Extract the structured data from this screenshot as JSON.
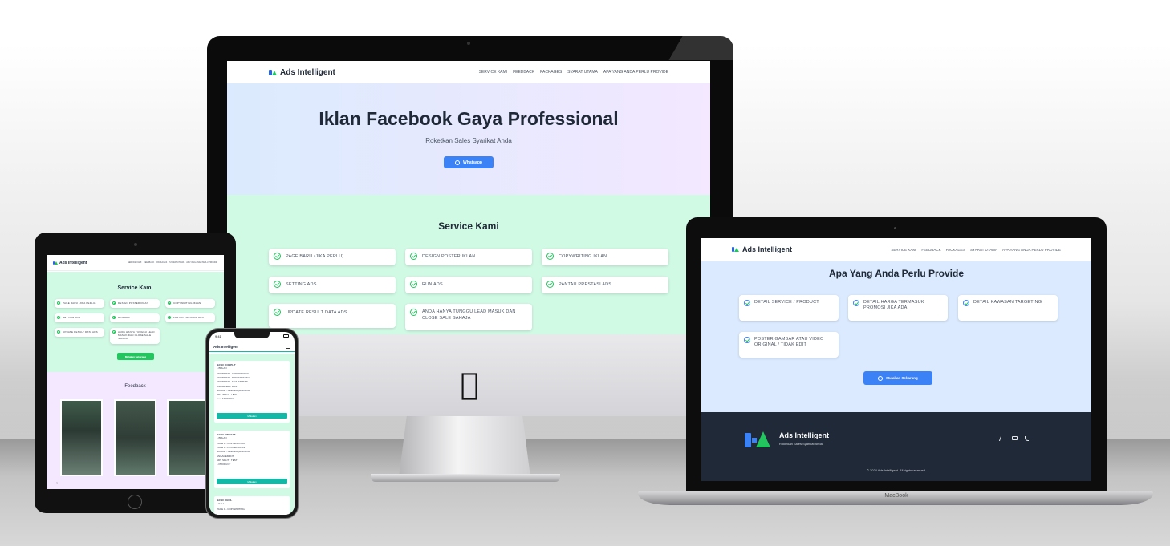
{
  "brand": "Ads Intelligent",
  "brand_icon_text": "FA",
  "nav_links": [
    "SERVICE KAMI",
    "FEEDBACK",
    "PACKAGES",
    "SYARAT UTAMA",
    "APA YANG ANDA PERLU PROVIDE"
  ],
  "imac": {
    "hero_title": "Iklan Facebook Gaya Professional",
    "hero_subtitle": "Roketkan Sales Syarikat Anda",
    "hero_button": "Whatsapp",
    "section_title": "Service Kami",
    "services": [
      "PAGE BARU (JIKA PERLU)",
      "DESIGN POSTER IKLAN",
      "COPYWRITING IKLAN",
      "SETTING ADS",
      "RUN ADS",
      "PANTAU PRESTASI ADS",
      "UPDATE RESULT DATA ADS",
      "ANDA HANYA TUNGGU LEAD MASUK DAN CLOSE SALE SAHAJA"
    ],
    "device_label": ""
  },
  "laptop": {
    "section_title": "Apa Yang Anda Perlu Provide",
    "items": [
      "DETAIL SERVICE / PRODUCT",
      "DETAIL HARGA TERMASUK PROMOSI JIKA ADA",
      "DETAIL KAWASAN TARGETING",
      "POSTER GAMBAR ATAU VIDEO ORIGINAL / TIDAK EDIT"
    ],
    "cta_button": "Mulakan Sekarang",
    "footer_brand": "Ads Intelligent",
    "footer_tagline": "Roketkan Sales Syarikat Anda",
    "footer_copyright": "© 2024 Ads Intelligent. All rights reserved.",
    "device_label": "MacBook"
  },
  "tablet": {
    "section_title": "Service Kami",
    "services": [
      "PAGE BARU (JIKA PERLU)",
      "DESIGN POSTER IKLAN",
      "COPYWRITING IKLAN",
      "SETTING ADS",
      "RUN ADS",
      "PANTAU PRESTASI ADS",
      "UPDATE RESULT DATA ADS",
      "ANDA HANYA TUNGGU LEAD MASUK DAN CLOSE SALE SAHAJA"
    ],
    "cta_button": "Mulakan Sekarang",
    "feedback_title": "Feedback"
  },
  "phone": {
    "time": "9:41",
    "brand": "Ads Intelligent",
    "packages": [
      {
        "name": "BASIC KOMPLIT",
        "price": "1 BULAN",
        "features": [
          "UNLIMITED - COPYWRITING",
          "UNLIMITED - POSTER IKLAN",
          "UNLIMITED - ADJUSTMENT",
          "UNLIMITED - RUN",
          "SOCIAL - SPECIAL (RM/DATA)",
          "ADS SPLIT - TEST",
          "1 - 1 PRODUCT"
        ],
        "button": "Mulakan"
      },
      {
        "name": "BASIC SINGKAT",
        "price": "1 BULAN",
        "features": [
          "PAGE 1 - COPYWRITING",
          "PAGE 1 - POSTER IKLAN",
          "SOCIAL - SPECIAL (RM/DATA)",
          "ENGAGEMENT",
          "ADS SPLIT - TEST",
          "1 PRODUCT"
        ],
        "button": "Mulakan"
      },
      {
        "name": "BASIC KECIL",
        "price": "1 KALI",
        "features": [
          "PAGE 1 - COPYWRITING"
        ],
        "button": ""
      }
    ]
  },
  "colors": {
    "accent_blue": "#3b82f6",
    "accent_green": "#22c55e",
    "teal_button": "#14b8a6",
    "footer_bg": "#1f2937"
  }
}
